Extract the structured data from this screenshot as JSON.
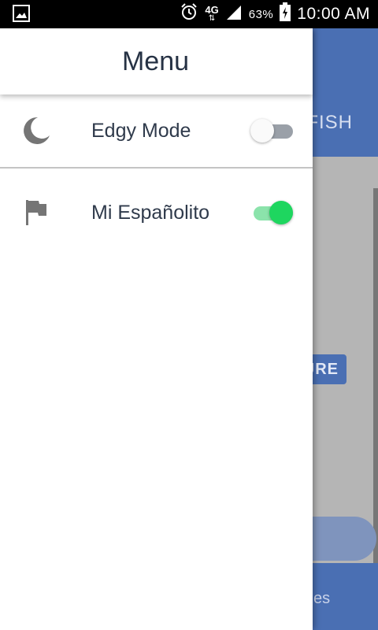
{
  "status_bar": {
    "network": "4G",
    "battery_percent": "63%",
    "time": "10:00 AM",
    "icons": [
      "gallery-icon",
      "alarm-icon",
      "network-arrows-icon",
      "signal-icon",
      "battery-charging-icon"
    ]
  },
  "background_app": {
    "header_text": "FISH",
    "chip_text": "URE",
    "bottom_text": "es",
    "colors": {
      "primary": "#4a6fb3",
      "scrim": "#b5b5b5"
    }
  },
  "drawer": {
    "title": "Menu",
    "items": [
      {
        "label": "Edgy Mode",
        "icon": "moon-icon",
        "enabled": false
      },
      {
        "label": "Mi Españolito",
        "icon": "flag-icon",
        "enabled": true
      }
    ],
    "colors": {
      "toggle_on": "#1ed65f",
      "toggle_off": "#9aa0a8"
    }
  }
}
